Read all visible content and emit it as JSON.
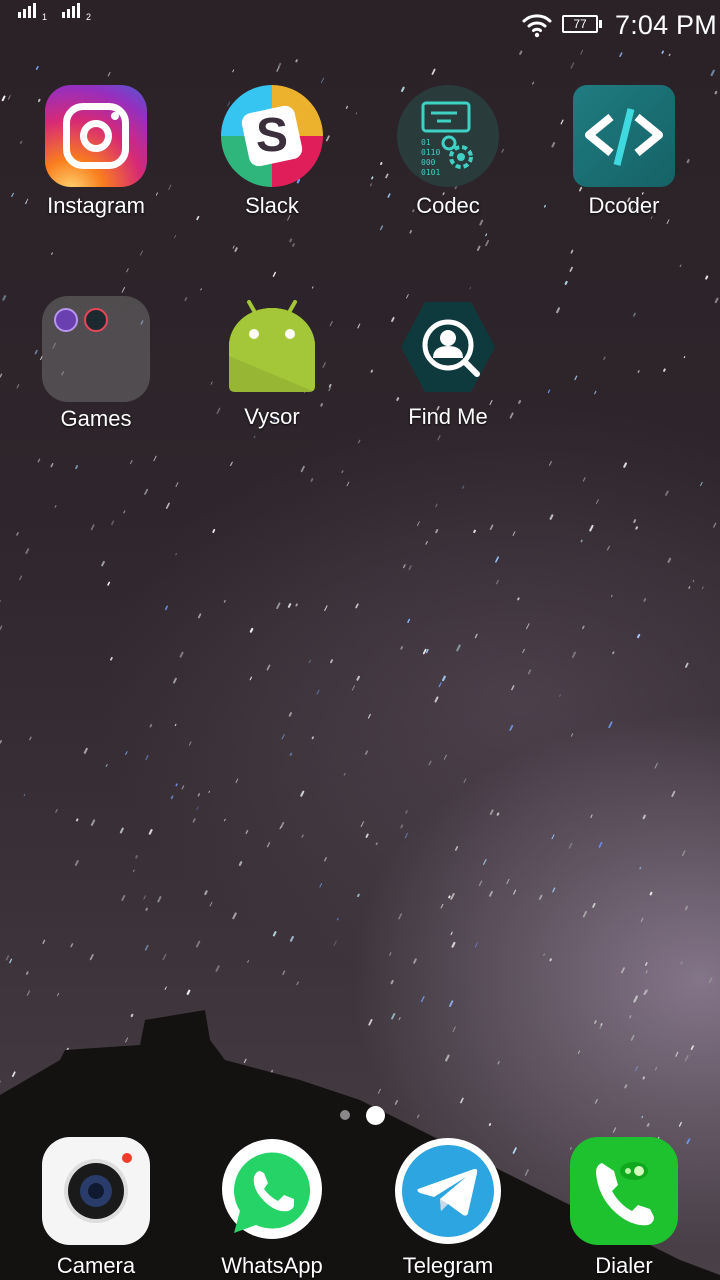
{
  "status_bar": {
    "sim1_label": "1",
    "sim2_label": "2",
    "wifi_icon": "wifi-icon",
    "battery_level": "77",
    "time": "7:04 PM"
  },
  "apps": [
    {
      "label": "Instagram",
      "icon": "instagram-icon"
    },
    {
      "label": "Slack",
      "icon": "slack-icon"
    },
    {
      "label": "Codec",
      "icon": "codec-icon"
    },
    {
      "label": "Dcoder",
      "icon": "dcoder-icon"
    },
    {
      "label": "Games",
      "icon": "folder-icon"
    },
    {
      "label": "Vysor",
      "icon": "android-icon"
    },
    {
      "label": "Find Me",
      "icon": "find-me-icon"
    }
  ],
  "page_indicator": {
    "pages": 2,
    "current": 2
  },
  "dock": [
    {
      "label": "Camera",
      "icon": "camera-icon"
    },
    {
      "label": "WhatsApp",
      "icon": "whatsapp-icon"
    },
    {
      "label": "Telegram",
      "icon": "telegram-icon"
    },
    {
      "label": "Dialer",
      "icon": "phone-icon"
    }
  ],
  "colors": {
    "instagram": "#d62976",
    "slack_yellow": "#ecb22e",
    "slack_red": "#e01e5a",
    "slack_green": "#2eb67d",
    "slack_blue": "#36c5f0",
    "dcoder": "#1f7c80",
    "codec_accent": "#3fd1c4",
    "android_green": "#a4c639",
    "whatsapp_green": "#25d366",
    "telegram_blue": "#2ca5e0",
    "dialer_green": "#1ec12e"
  }
}
